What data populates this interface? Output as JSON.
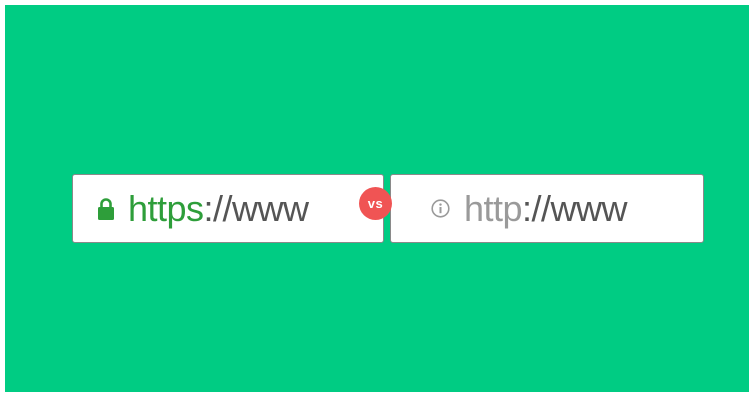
{
  "secure_url": {
    "scheme": "https",
    "rest": "://www",
    "icon": "lock-icon"
  },
  "insecure_url": {
    "scheme": "http",
    "rest": "://www",
    "icon": "info-icon"
  },
  "badge": {
    "label": "vs"
  },
  "colors": {
    "background": "#00cc83",
    "secure_green": "#2e9e3a",
    "insecure_gray": "#9a9a9a",
    "url_dark": "#555555",
    "badge_red": "#f05454"
  }
}
